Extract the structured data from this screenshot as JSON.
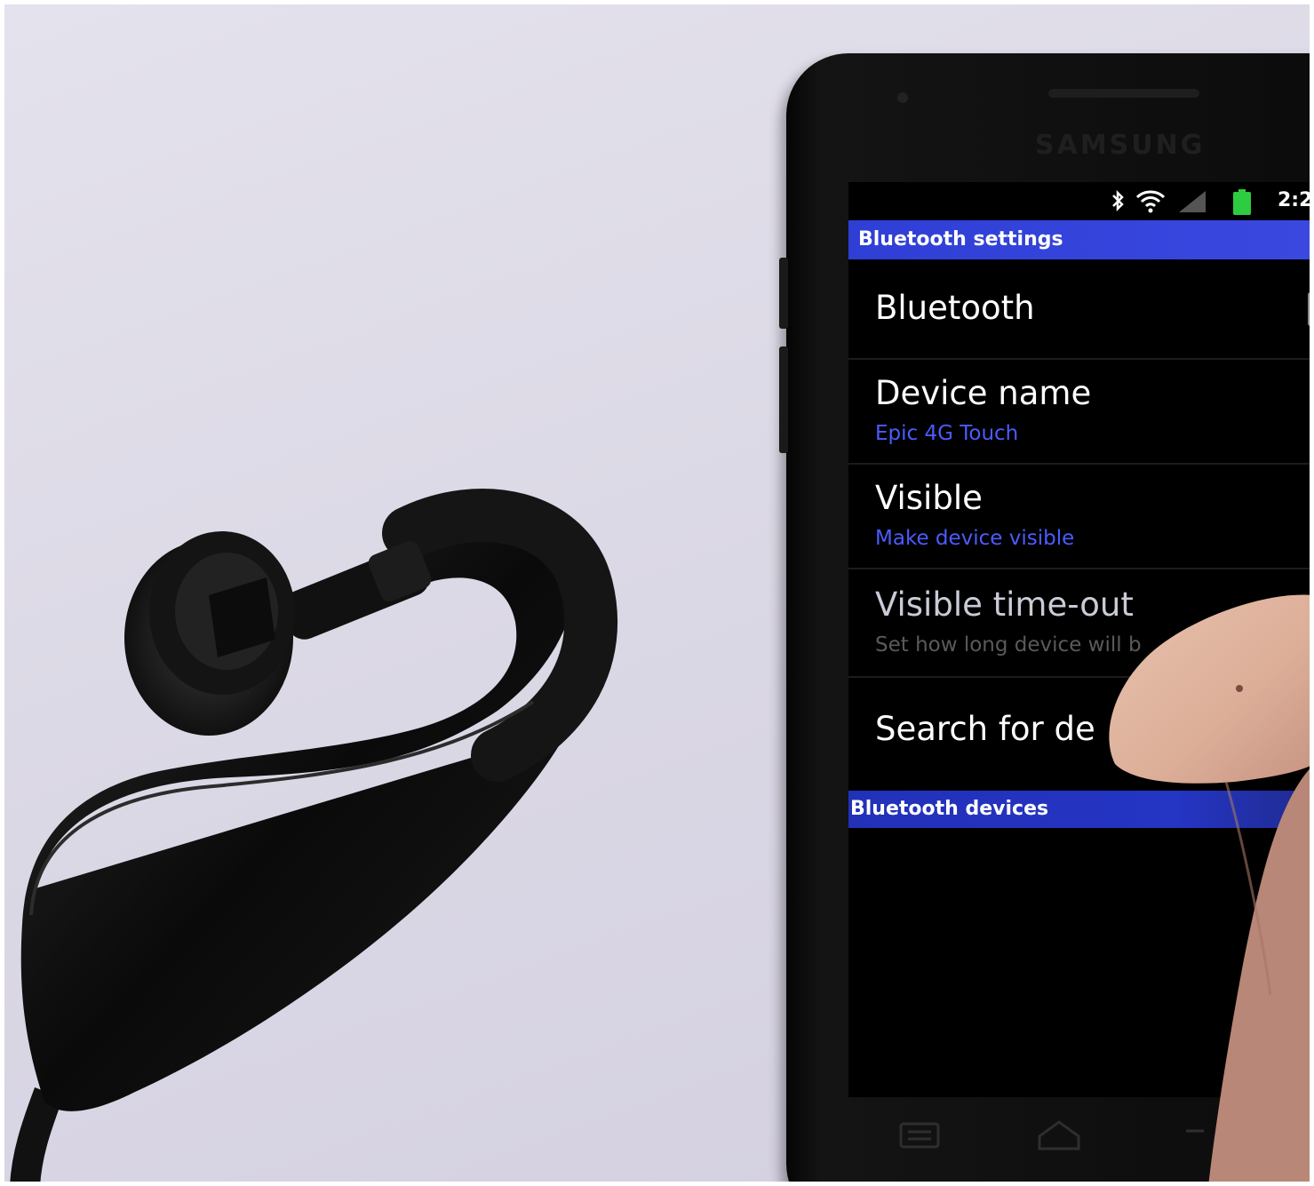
{
  "phone": {
    "brand": "SAMSUNG",
    "status_bar": {
      "time": "2:2",
      "icons": [
        "bluetooth-icon",
        "wifi-icon",
        "signal-icon",
        "battery-icon"
      ],
      "battery_color": "#2ecc40"
    },
    "title_bar": {
      "label": "Bluetooth settings",
      "color": "#3a48e0"
    },
    "settings": [
      {
        "title": "Bluetooth",
        "subtitle": ""
      },
      {
        "title": "Device name",
        "subtitle": "Epic 4G Touch"
      },
      {
        "title": "Visible",
        "subtitle": "Make device visible"
      },
      {
        "title": "Visible time-out",
        "subtitle": "Set how long device will b"
      },
      {
        "title": "Search for de",
        "subtitle": ""
      }
    ],
    "section_header": "Bluetooth devices",
    "nav_keys": [
      "menu-icon",
      "home-icon",
      "back-icon"
    ],
    "accent_color": "#4a5cff"
  }
}
